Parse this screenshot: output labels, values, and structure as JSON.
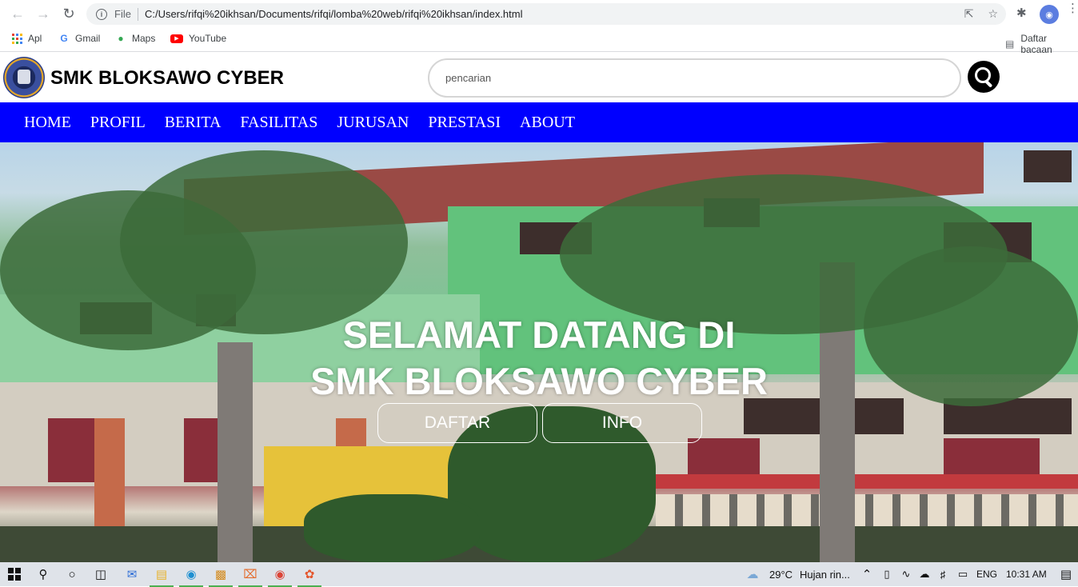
{
  "browser": {
    "file_label": "File",
    "url": "C:/Users/rifqi%20ikhsan/Documents/rifqi/lomba%20web/rifqi%20ikhsan/index.html",
    "profile_initial": "◉",
    "bookmarks": [
      {
        "label": "Apl",
        "icon": "apps-icon"
      },
      {
        "label": "Gmail",
        "icon": "google-icon"
      },
      {
        "label": "Maps",
        "icon": "maps-icon"
      },
      {
        "label": "YouTube",
        "icon": "youtube-icon"
      }
    ],
    "reading_list": "Daftar bacaan"
  },
  "site": {
    "title": "SMK BLOKSAWO CYBER",
    "search_placeholder": "pencarian",
    "nav": [
      "HOME",
      "PROFIL",
      "BERITA",
      "FASILITAS",
      "JURUSAN",
      "PRESTASI",
      "ABOUT"
    ],
    "hero": {
      "line1": "SELAMAT DATANG DI",
      "line2": "SMK BLOKSAWO CYBER",
      "btn_daftar": "DAFTAR",
      "btn_info": "INFO"
    }
  },
  "taskbar": {
    "weather_temp": "29°C",
    "weather_desc": "Hujan rin...",
    "language": "ENG",
    "time": "10:31 AM"
  },
  "colors": {
    "nav_bg": "#0000ff",
    "search_button": "#000000"
  }
}
